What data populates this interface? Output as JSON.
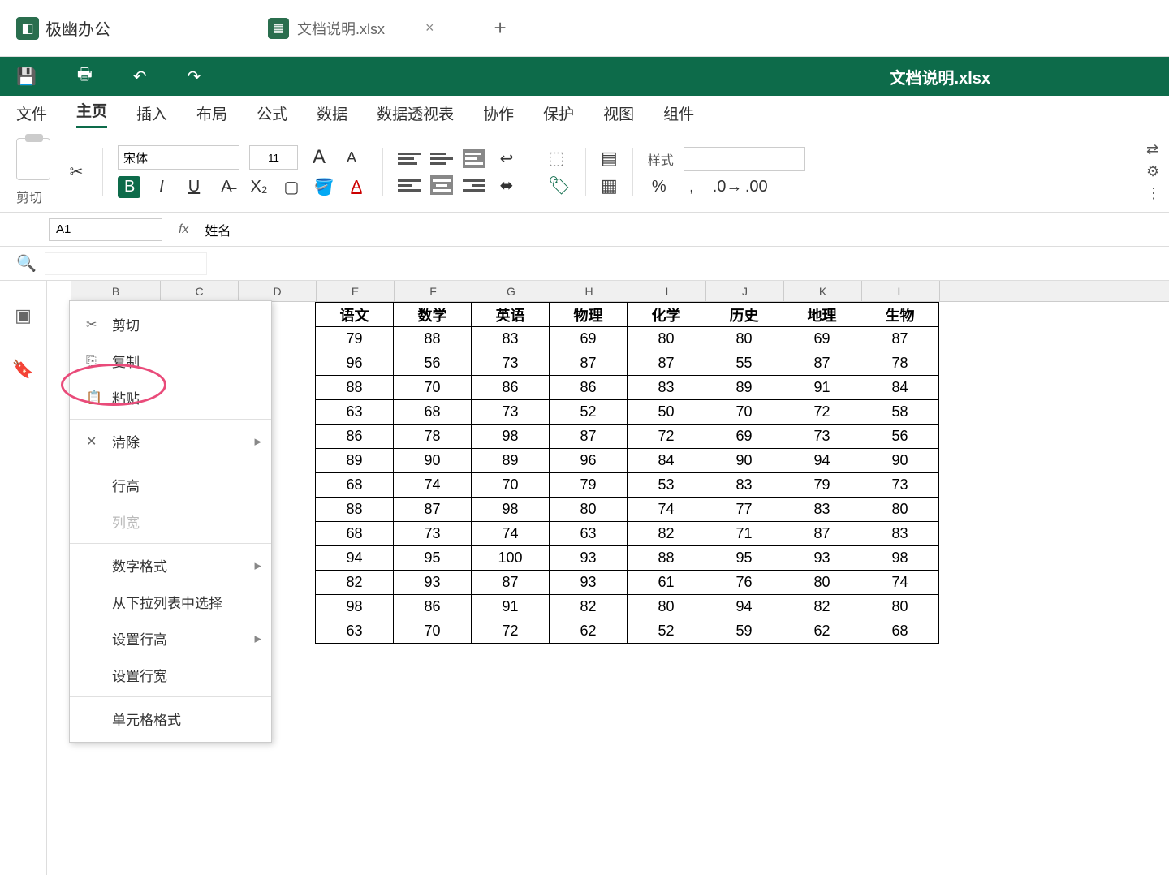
{
  "app": {
    "name": "极幽办公"
  },
  "tab": {
    "name": "文档说明.xlsx",
    "doc_title": "文档说明.xlsx"
  },
  "menubar": [
    "文件",
    "主页",
    "插入",
    "布局",
    "公式",
    "数据",
    "数据透视表",
    "协作",
    "保护",
    "视图",
    "组件"
  ],
  "ribbon": {
    "clipboard_label": "剪切",
    "font_name": "宋体",
    "font_size": "11",
    "style_label": "样式"
  },
  "formula": {
    "cell_ref": "A1",
    "fx": "fx",
    "name_label": "姓名"
  },
  "columns": [
    "B",
    "C",
    "D",
    "E",
    "F",
    "G",
    "H",
    "I",
    "J",
    "K",
    "L"
  ],
  "col_b_width": 110,
  "data_col_width": 96,
  "context_menu": {
    "cut": "剪切",
    "copy": "复制",
    "paste": "粘贴",
    "clear": "清除",
    "row_height": "行高",
    "col_width": "列宽",
    "number_format": "数字格式",
    "dropdown_select": "从下拉列表中选择",
    "set_rowcol": "设置行高",
    "merge_cells": "设置行宽",
    "format_cells": "单元格格式"
  },
  "chart_data": {
    "type": "table",
    "headers": [
      "语文",
      "数学",
      "英语",
      "物理",
      "化学",
      "历史",
      "地理",
      "生物"
    ],
    "rows": [
      [
        79,
        88,
        83,
        69,
        80,
        80,
        69,
        87
      ],
      [
        96,
        56,
        73,
        87,
        87,
        55,
        87,
        78
      ],
      [
        88,
        70,
        86,
        86,
        83,
        89,
        91,
        84
      ],
      [
        63,
        68,
        73,
        52,
        50,
        70,
        72,
        58
      ],
      [
        86,
        78,
        98,
        87,
        72,
        69,
        73,
        56
      ],
      [
        89,
        90,
        89,
        96,
        84,
        90,
        94,
        90
      ],
      [
        68,
        74,
        70,
        79,
        53,
        83,
        79,
        73
      ],
      [
        88,
        87,
        98,
        80,
        74,
        77,
        83,
        80
      ],
      [
        68,
        73,
        74,
        63,
        82,
        71,
        87,
        83
      ],
      [
        94,
        95,
        100,
        93,
        88,
        95,
        93,
        98
      ],
      [
        82,
        93,
        87,
        93,
        61,
        76,
        80,
        74
      ],
      [
        98,
        86,
        91,
        82,
        80,
        94,
        82,
        80
      ],
      [
        63,
        70,
        72,
        62,
        52,
        59,
        62,
        68
      ]
    ]
  }
}
